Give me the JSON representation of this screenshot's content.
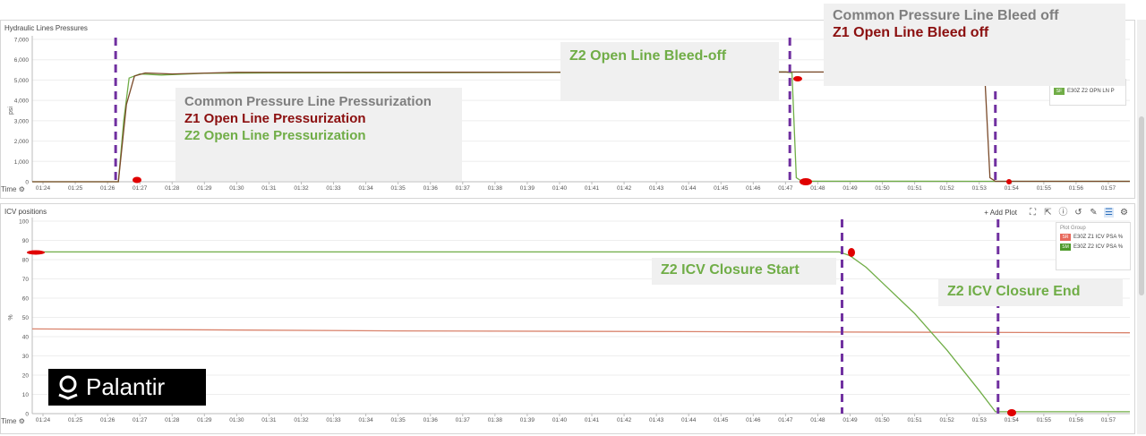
{
  "panels": {
    "top": {
      "title": "Hydraulic Lines Pressures",
      "ylabel": "psi",
      "time_label": "Time ⚙"
    },
    "bottom": {
      "title": "ICV positions",
      "ylabel": "%",
      "time_label": "Time ⚙",
      "toolbar": {
        "add_plot": "+ Add Plot"
      }
    }
  },
  "legends": {
    "top": [
      {
        "badge": "SF",
        "label": "E30Z Z2 OPN LN P",
        "color": "#70ad47"
      }
    ],
    "bottom_group": "Plot Group",
    "bottom": [
      {
        "badge": "SR",
        "label": "E30Z Z1 ICV PSA %",
        "color": "#e8695c"
      },
      {
        "badge": "SM",
        "label": "E30Z Z2 ICV PSA %",
        "color": "#4e9a2a"
      }
    ]
  },
  "annotations": {
    "pressurization": {
      "line1": "Common  Pressure Line Pressurization",
      "line2": "Z1 Open Line Pressurization",
      "line3": "Z2 Open Line Pressurization"
    },
    "z2_bleed": "Z2 Open Line Bleed-off",
    "common_bleed": {
      "line1": "Common Pressure  Line Bleed off",
      "line2": "Z1 Open Line Bleed off"
    },
    "icv_start": "Z2 ICV Closure Start",
    "icv_end": "Z2 ICV Closure End"
  },
  "logo": {
    "text": "Palantir"
  },
  "colors": {
    "z1": "#a0522d",
    "z2": "#70ad47",
    "marker": "#7030a0",
    "highlight": "#e00000"
  },
  "chart_data": [
    {
      "type": "line",
      "title": "Hydraulic Lines Pressures",
      "ylabel": "psi",
      "ylim": [
        0,
        7000
      ],
      "yticks": [
        "0",
        "1,000",
        "2,000",
        "3,000",
        "4,000",
        "5,000",
        "6,000",
        "7,000"
      ],
      "xticks": [
        "01:24",
        "01:25",
        "01:26",
        "01:27",
        "01:28",
        "01:29",
        "01:30",
        "01:31",
        "01:32",
        "01:33",
        "01:34",
        "01:35",
        "01:36",
        "01:37",
        "01:38",
        "01:39",
        "01:40",
        "01:41",
        "01:42",
        "01:43",
        "01:44",
        "01:45",
        "01:46",
        "01:47",
        "01:48",
        "01:49",
        "01:50",
        "01:51",
        "01:52",
        "01:53",
        "01:54",
        "01:55",
        "01:56",
        "01:57"
      ],
      "xlim": [
        "01:23:40",
        "01:57:40"
      ],
      "series": [
        {
          "name": "E30Z Z2 OPN LN P",
          "x": [
            "01:23:40",
            "01:26:20",
            "01:26:30",
            "01:26:40",
            "01:27:00",
            "01:27:40",
            "01:29:00",
            "01:31:00",
            "01:40:00",
            "01:47:00",
            "01:47:12",
            "01:47:20",
            "01:47:30",
            "01:53:00",
            "01:57:40"
          ],
          "y": [
            0,
            0,
            3000,
            5100,
            5300,
            5250,
            5330,
            5350,
            5380,
            5400,
            5350,
            200,
            30,
            20,
            20
          ]
        },
        {
          "x": [
            "01:23:40",
            "01:26:20",
            "01:26:35",
            "01:26:50",
            "01:27:10",
            "01:28:00",
            "01:30:00",
            "01:40:00",
            "01:53:10",
            "01:53:20",
            "01:53:30",
            "01:57:40"
          ],
          "y": [
            0,
            0,
            3800,
            5200,
            5350,
            5300,
            5380,
            5390,
            5400,
            200,
            20,
            20
          ]
        }
      ],
      "markers_x": [
        "01:26:15",
        "01:47:08",
        "01:53:30"
      ]
    },
    {
      "type": "line",
      "title": "ICV positions",
      "ylabel": "%",
      "ylim": [
        0,
        100
      ],
      "yticks": [
        "0",
        "10",
        "20",
        "30",
        "40",
        "50",
        "60",
        "70",
        "80",
        "90",
        "100"
      ],
      "xticks": [
        "01:24",
        "01:25",
        "01:26",
        "01:27",
        "01:28",
        "01:29",
        "01:30",
        "01:31",
        "01:32",
        "01:33",
        "01:34",
        "01:35",
        "01:36",
        "01:37",
        "01:38",
        "01:39",
        "01:40",
        "01:41",
        "01:42",
        "01:43",
        "01:44",
        "01:45",
        "01:46",
        "01:47",
        "01:48",
        "01:49",
        "01:50",
        "01:51",
        "01:52",
        "01:53",
        "01:54",
        "01:55",
        "01:56",
        "01:57"
      ],
      "xlim": [
        "01:23:40",
        "01:57:40"
      ],
      "series": [
        {
          "name": "E30Z Z1 ICV PSA %",
          "x": [
            "01:23:00",
            "01:35:00",
            "01:46:00",
            "01:57:40"
          ],
          "y": [
            44,
            43,
            42.5,
            42
          ]
        },
        {
          "name": "E30Z Z2 ICV PSA %",
          "x": [
            "01:23:40",
            "01:48:40",
            "01:49:00",
            "01:49:30",
            "01:50:00",
            "01:51:00",
            "01:52:00",
            "01:53:00",
            "01:53:30",
            "01:57:40"
          ],
          "y": [
            84,
            84,
            82,
            76,
            68,
            52,
            33,
            12,
            1,
            1
          ]
        }
      ],
      "markers_x": [
        "01:48:45",
        "01:53:35"
      ]
    }
  ]
}
